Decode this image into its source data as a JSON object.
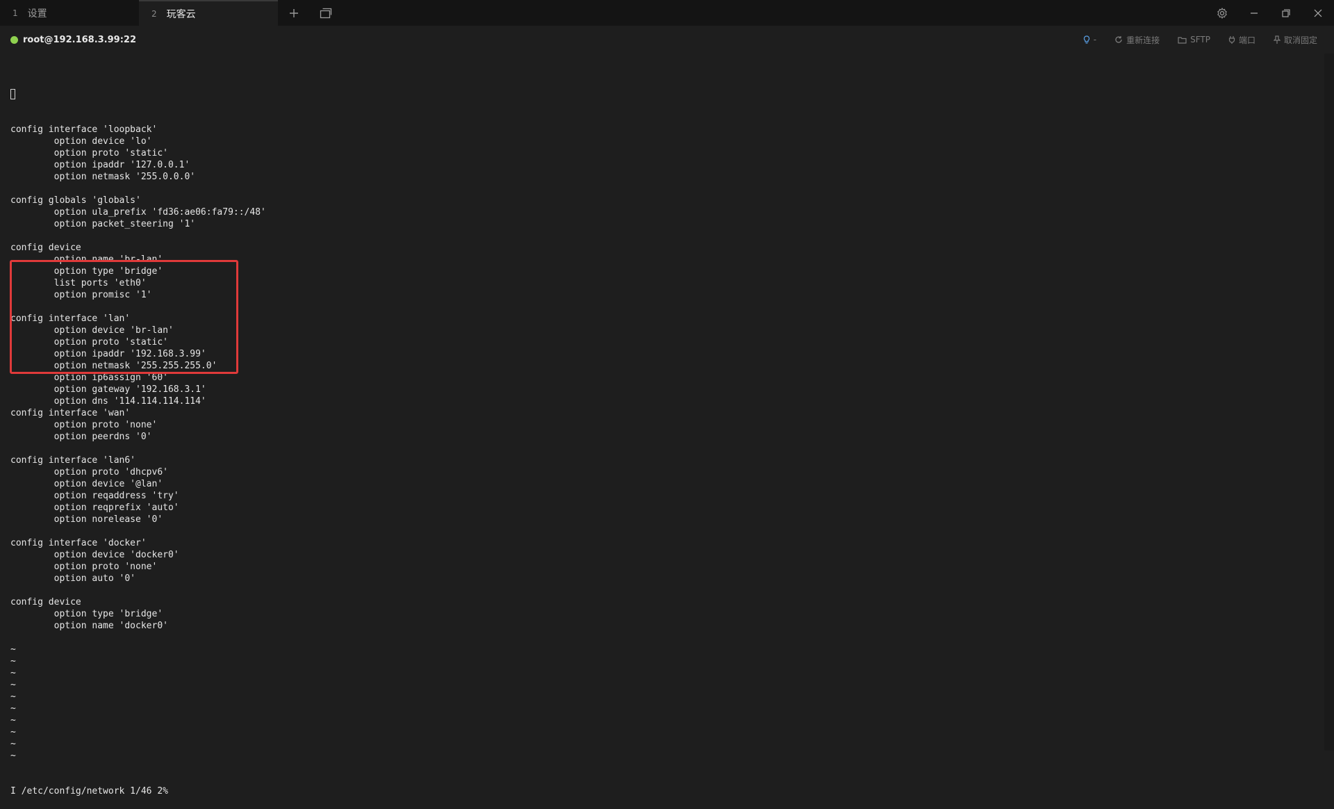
{
  "tabs": [
    {
      "number": "1",
      "label": "设置"
    },
    {
      "number": "2",
      "label": "玩客云"
    }
  ],
  "session": {
    "title": "root@192.168.3.99:22",
    "status_color": "#8fd14f",
    "actions": {
      "hint_label": "-",
      "reconnect_label": "重新连接",
      "sftp_label": "SFTP",
      "port_label": "端口",
      "unpin_label": "取消固定"
    }
  },
  "terminal": {
    "lines": [
      "config interface 'loopback'",
      "        option device 'lo'",
      "        option proto 'static'",
      "        option ipaddr '127.0.0.1'",
      "        option netmask '255.0.0.0'",
      "",
      "config globals 'globals'",
      "        option ula_prefix 'fd36:ae06:fa79::/48'",
      "        option packet_steering '1'",
      "",
      "config device",
      "        option name 'br-lan'",
      "        option type 'bridge'",
      "        list ports 'eth0'",
      "        option promisc '1'",
      "",
      "config interface 'lan'",
      "        option device 'br-lan'",
      "        option proto 'static'",
      "        option ipaddr '192.168.3.99'",
      "        option netmask '255.255.255.0'",
      "        option ip6assign '60'",
      "        option gateway '192.168.3.1'",
      "        option dns '114.114.114.114'",
      "config interface 'wan'",
      "        option proto 'none'",
      "        option peerdns '0'",
      "",
      "config interface 'lan6'",
      "        option proto 'dhcpv6'",
      "        option device '@lan'",
      "        option reqaddress 'try'",
      "        option reqprefix 'auto'",
      "        option norelease '0'",
      "",
      "config interface 'docker'",
      "        option device 'docker0'",
      "        option proto 'none'",
      "        option auto '0'",
      "",
      "config device",
      "        option type 'bridge'",
      "        option name 'docker0'",
      "",
      "~",
      "~",
      "~",
      "~",
      "~",
      "~",
      "~",
      "~",
      "~",
      "~"
    ],
    "status_line": "I /etc/config/network 1/46 2%",
    "highlight_color": "#e03a3a"
  }
}
